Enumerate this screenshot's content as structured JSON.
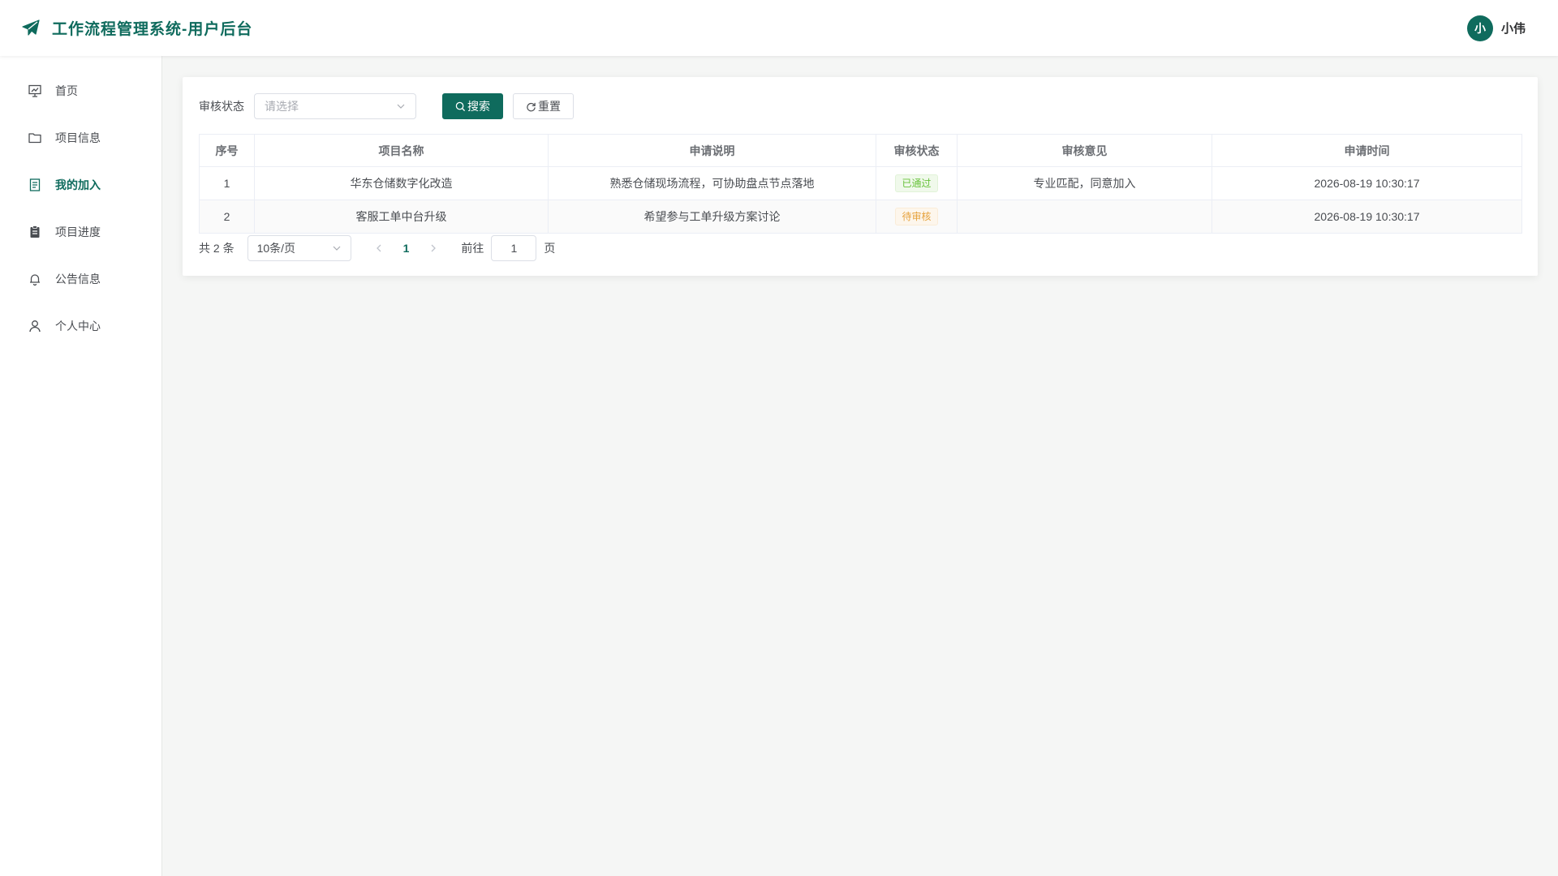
{
  "header": {
    "title": "工作流程管理系统-用户后台",
    "user": {
      "avatar_text": "小",
      "name": "小伟"
    }
  },
  "sidebar": {
    "items": [
      {
        "label": "首页",
        "icon": "dashboard-icon",
        "active": false
      },
      {
        "label": "项目信息",
        "icon": "folder-icon",
        "active": false
      },
      {
        "label": "我的加入",
        "icon": "document-icon",
        "active": true
      },
      {
        "label": "项目进度",
        "icon": "clipboard-icon",
        "active": false
      },
      {
        "label": "公告信息",
        "icon": "bell-icon",
        "active": false
      },
      {
        "label": "个人中心",
        "icon": "user-icon",
        "active": false
      }
    ]
  },
  "filter": {
    "label": "审核状态",
    "placeholder": "请选择",
    "search_label": "搜索",
    "reset_label": "重置"
  },
  "table": {
    "columns": [
      "序号",
      "项目名称",
      "申请说明",
      "审核状态",
      "审核意见",
      "申请时间"
    ],
    "rows": [
      {
        "index": "1",
        "project": "华东仓储数字化改造",
        "description": "熟悉仓储现场流程，可协助盘点节点落地",
        "status": "已通过",
        "status_type": "success",
        "opinion": "专业匹配，同意加入",
        "time": "2026-08-19 10:30:17"
      },
      {
        "index": "2",
        "project": "客服工单中台升级",
        "description": "希望参与工单升级方案讨论",
        "status": "待审核",
        "status_type": "warning",
        "opinion": "",
        "time": "2026-08-19 10:30:17"
      }
    ]
  },
  "pagination": {
    "total_text": "共 2 条",
    "page_size": "10条/页",
    "current_page": "1",
    "goto_prefix": "前往",
    "goto_value": "1",
    "goto_suffix": "页"
  },
  "colors": {
    "brand": "#0f6b5d",
    "success": "#67c23a",
    "warning": "#e6a23c"
  }
}
